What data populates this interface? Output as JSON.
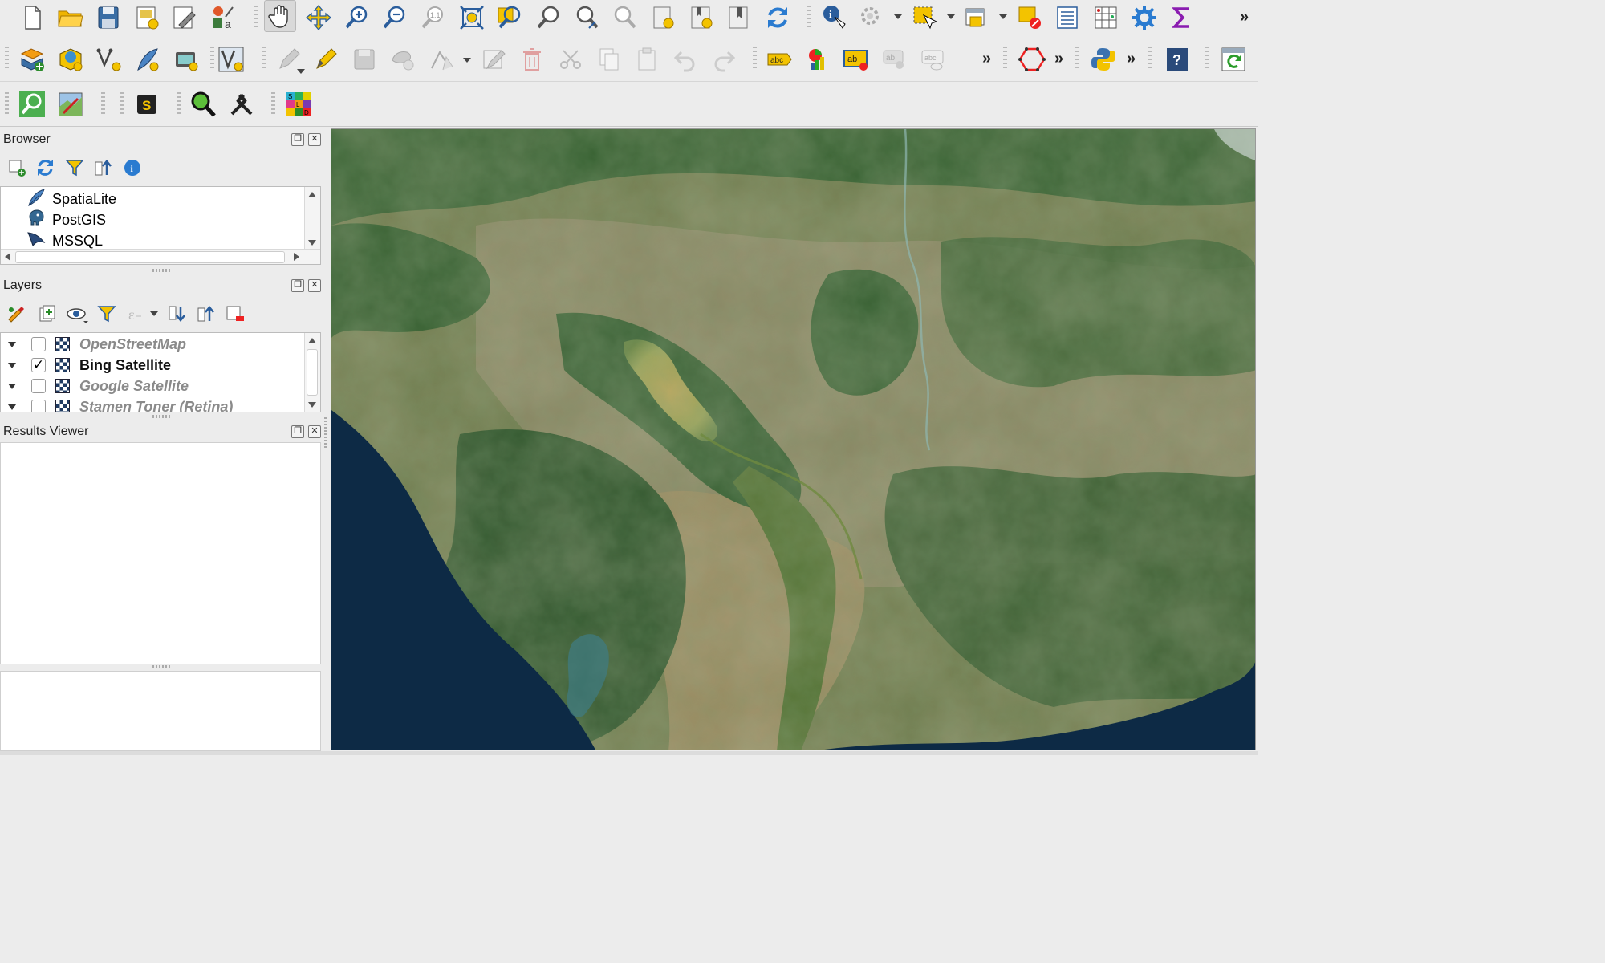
{
  "colors": {
    "toolbar_bg": "#ececec",
    "ocean": "#0d2a45",
    "forest": "#2c5a2a",
    "land": "#8a8a62",
    "lake": "#b59a4a"
  },
  "toolbar": {
    "row1_icons": [
      "new-project-icon",
      "open-project-icon",
      "save-project-icon",
      "new-print-layout-icon",
      "layout-manager-icon",
      "style-manager-icon",
      "pan-map-icon",
      "pan-to-selection-icon",
      "zoom-in-icon",
      "zoom-out-icon",
      "zoom-native-icon",
      "zoom-full-icon",
      "zoom-to-selection-icon",
      "zoom-to-layer-icon",
      "zoom-last-icon",
      "zoom-next-icon",
      "new-bookmark-icon",
      "show-bookmarks-icon",
      "temporal-controller-icon",
      "refresh-icon",
      "identify-icon",
      "actions-icon",
      "select-features-icon",
      "open-attribute-table-icon",
      "deselect-all-icon",
      "field-calculator-icon",
      "statistical-summary-icon",
      "processing-toolbox-icon",
      "sum-icon"
    ],
    "row2_icons": [
      "datasource-manager-icon",
      "new-geopackage-icon",
      "new-shapefile-icon",
      "new-spatialite-icon",
      "new-virtual-layer-icon",
      "digitize-icon",
      "current-edits-icon",
      "toggle-editing-icon",
      "save-edits-icon",
      "add-feature-icon",
      "vertex-tool-icon",
      "modify-attributes-icon",
      "delete-selected-icon",
      "cut-features-icon",
      "copy-features-icon",
      "paste-features-icon",
      "undo-icon",
      "redo-icon",
      "label-tool-icon",
      "diagram-icon",
      "layer-labeling-icon",
      "pin-labels-icon",
      "show-hide-labels-icon",
      "shape-digitizing-icon",
      "python-console-icon",
      "help-icon",
      "plugin-update-icon"
    ],
    "row3_icons": [
      "quick-map-services-icon",
      "georeferencer-icon",
      "stamen-s-icon",
      "search-magnifier-icon",
      "hammer-tools-icon",
      "sld-editor-icon"
    ],
    "more_label": "»"
  },
  "browser": {
    "title": "Browser",
    "tool_icons": [
      "add-selected-layers-icon",
      "refresh-icon",
      "filter-icon",
      "collapse-all-icon",
      "properties-info-icon"
    ],
    "items": [
      {
        "label": "SpatiaLite",
        "icon": "spatialite-feather-icon"
      },
      {
        "label": "PostGIS",
        "icon": "postgis-elephant-icon"
      },
      {
        "label": "MSSQL",
        "icon": "mssql-icon"
      }
    ]
  },
  "layers": {
    "title": "Layers",
    "tool_icons": [
      "style-manager-icon",
      "add-group-icon",
      "manage-map-themes-icon",
      "filter-legend-icon",
      "filter-expression-icon",
      "expand-all-icon",
      "collapse-all-icon",
      "remove-layer-icon"
    ],
    "items": [
      {
        "label": "OpenStreetMap",
        "checked": false
      },
      {
        "label": "Bing Satellite",
        "checked": true
      },
      {
        "label": "Google Satellite",
        "checked": false
      },
      {
        "label": "Stamen Toner (Retina)",
        "checked": false
      }
    ],
    "check_mark": "✓"
  },
  "results": {
    "title": "Results Viewer"
  },
  "panel_buttons": {
    "float": "❐",
    "close": "✕"
  }
}
